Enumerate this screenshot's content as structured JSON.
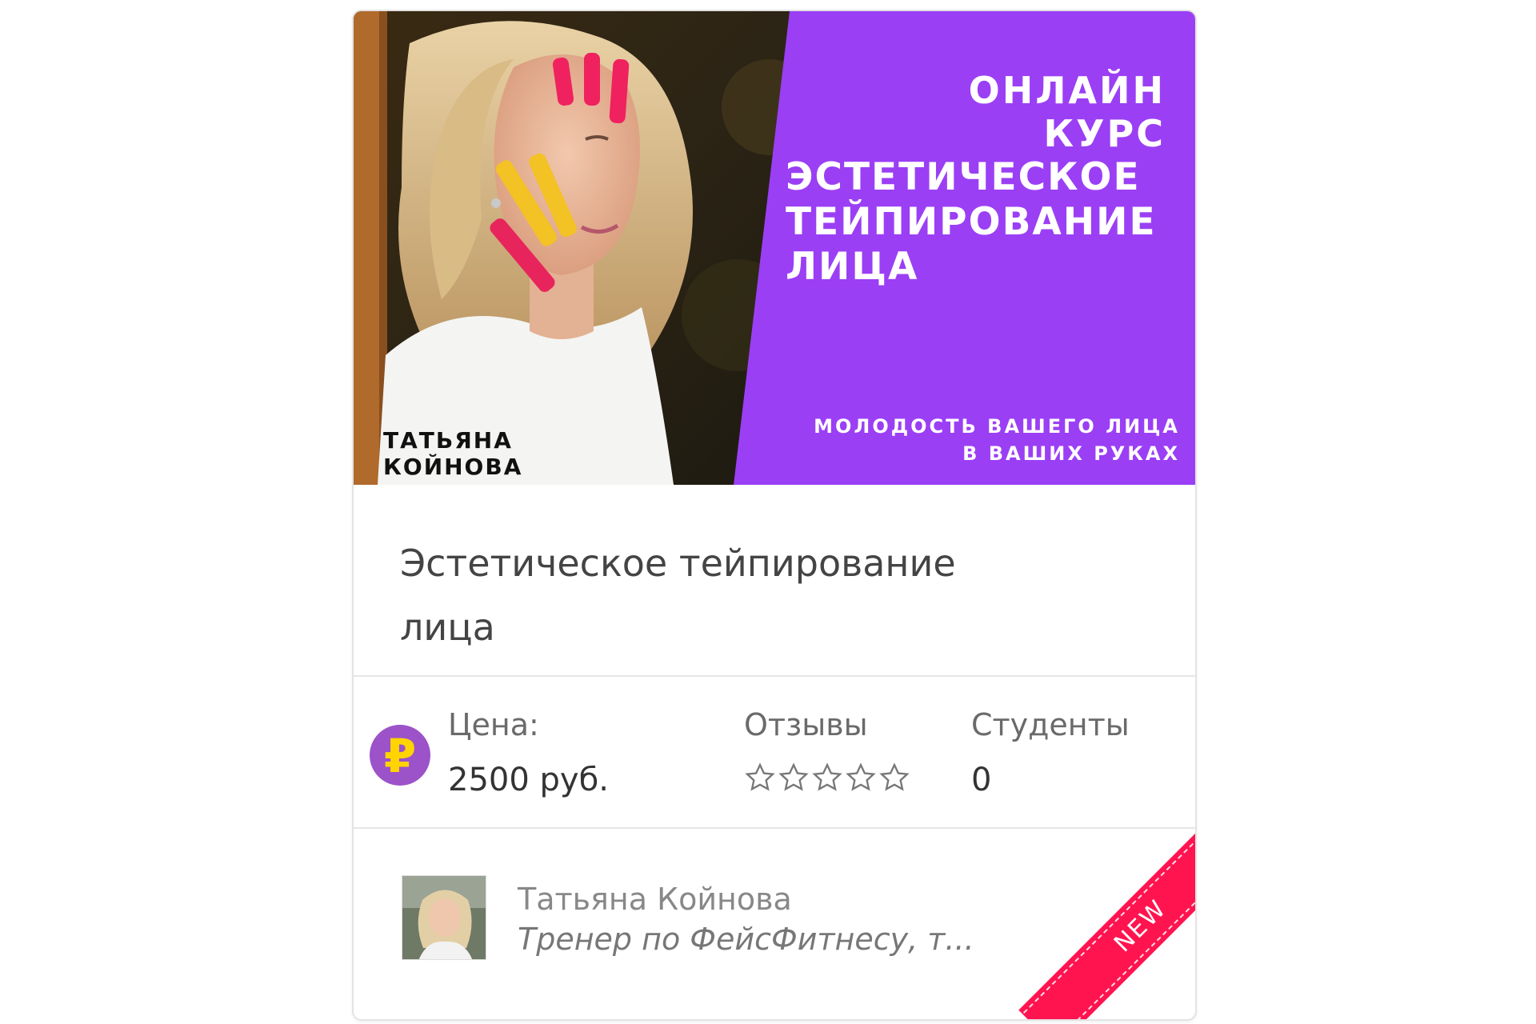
{
  "banner": {
    "kicker": "ОНЛАЙН КУРС",
    "title": "ЭСТЕТИЧЕСКОЕ ТЕЙПИРОВАНИЕ ЛИЦА",
    "slogan": "МОЛОДОСТЬ ВАШЕГО ЛИЦА В ВАШИХ РУКАХ",
    "author_caption": "ТАТЬЯНА КОЙНОВА",
    "accent_color": "#9b3ff5"
  },
  "course": {
    "title": "Эстетическое тейпирование лица"
  },
  "stats": {
    "currency_icon": "ruble-icon",
    "currency_symbol": "₽",
    "price_label": "Цена:",
    "price_value": "2500 руб.",
    "reviews_label": "Отзывы",
    "rating": 0,
    "rating_max": 5,
    "students_label": "Студенты",
    "students_value": "0"
  },
  "author": {
    "name": "Татьяна Койнова",
    "description": "Тренер по ФейсФитнесу, т..."
  },
  "ribbon": {
    "label": "NEW",
    "color": "#ff1450"
  }
}
